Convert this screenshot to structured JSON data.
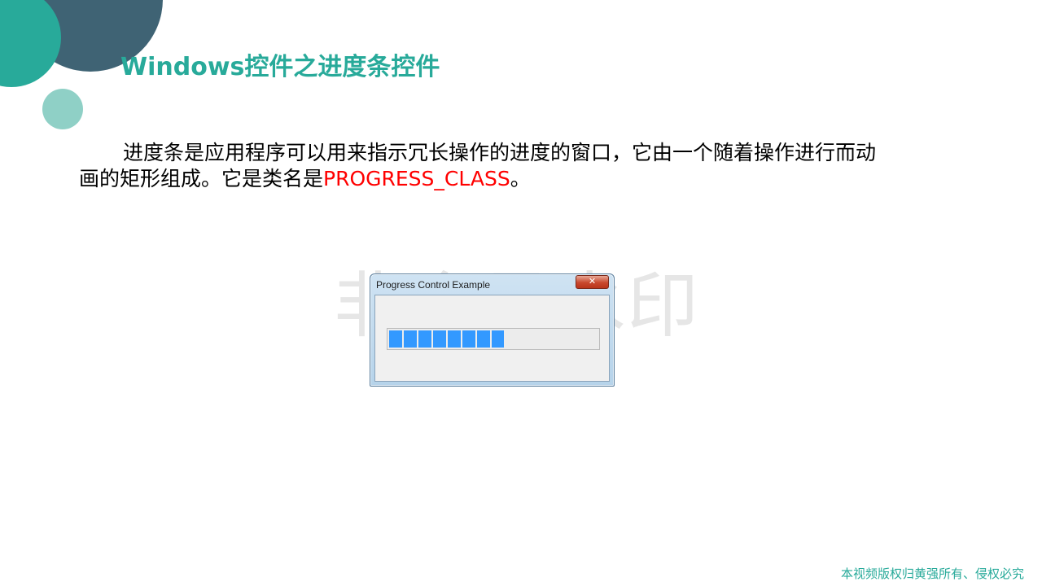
{
  "slide": {
    "title": "Windows控件之进度条控件",
    "body_text": "进度条是应用程序可以用来指示冗长操作的进度的窗口，它由一个随着操作进行而动画的矩形组成。它是类名是",
    "highlight_text": "PROGRESS_CLASS",
    "body_end": "。",
    "watermark": "非会员水印",
    "footer": "本视频版权归黄强所有、侵权必究"
  },
  "dialog": {
    "title": "Progress Control Example",
    "close_label": "✕",
    "progress_fraction": 0.55
  },
  "colors": {
    "accent_teal": "#28aa9a",
    "decor_dark": "#3f6374",
    "decor_light": "#8fd0c6",
    "highlight_red": "#ff0000",
    "progress_blue": "#3399ff"
  }
}
